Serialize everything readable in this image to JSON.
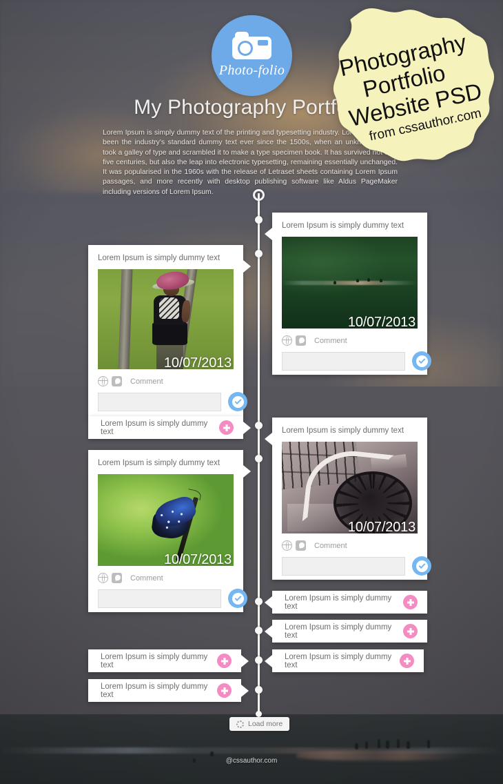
{
  "site": {
    "logo_name": "Photo-folio",
    "logo_icon": "camera-icon",
    "title": "My Photography Portfolio",
    "intro": "Lorem Ipsum is simply dummy text of the printing and typesetting industry. Lorem Ipsum has been the industry's standard dummy text ever since the 1500s, when an unknown printer took a galley of type and scrambled it to make a type specimen book. It has survived not only five centuries, but also the leap into electronic typesetting, remaining essentially unchanged. It was popularised in the 1960s with the release of Letraset sheets containing Lorem Ipsum passages, and more recently with desktop publishing software like Aldus PageMaker including versions of Lorem Ipsum.",
    "footer": "@cssauthor.com"
  },
  "badge": {
    "line1": "Photography",
    "line2": "Portfolio",
    "line3": "Website PSD",
    "line4": "from cssauthor.com",
    "color": "#f6f2bc"
  },
  "colors": {
    "accent_blue": "#74b7f2",
    "accent_pink": "#f48bc2",
    "logo_blue": "#6faae8",
    "card_white": "#ffffff"
  },
  "labels": {
    "comment": "Comment",
    "comment_placeholder": "",
    "load_more": "Load more",
    "post_icon": "check-icon",
    "add_icon": "plus-icon",
    "globe_icon": "globe-icon",
    "note_icon": "note-icon",
    "spinner_icon": "spinner-icon"
  },
  "posts": [
    {
      "id": "post-lake",
      "side": "right",
      "type": "photo",
      "title": "Lorem Ipsum is simply dummy text",
      "date": "10/07/2013",
      "photo": "lake-with-birds",
      "comment_label": "Comment",
      "comment_value": ""
    },
    {
      "id": "post-girl",
      "side": "left",
      "type": "photo",
      "title": "Lorem Ipsum is simply dummy text",
      "date": "10/07/2013",
      "photo": "girl-with-hat",
      "comment_label": "Comment",
      "comment_value": ""
    },
    {
      "id": "post-mini-left-1",
      "side": "left",
      "type": "text",
      "title": "Lorem Ipsum is simply dummy text"
    },
    {
      "id": "post-stairs",
      "side": "right",
      "type": "photo",
      "title": "Lorem Ipsum is simply dummy text",
      "date": "10/07/2013",
      "photo": "spiral-staircase",
      "comment_label": "Comment",
      "comment_value": ""
    },
    {
      "id": "post-butterfly",
      "side": "left",
      "type": "photo",
      "title": "Lorem Ipsum is simply dummy text",
      "date": "10/07/2013",
      "photo": "blue-butterfly",
      "comment_label": "Comment",
      "comment_value": ""
    },
    {
      "id": "post-mini-right-1",
      "side": "right",
      "type": "text",
      "title": "Lorem Ipsum is simply dummy text"
    },
    {
      "id": "post-mini-right-2",
      "side": "right",
      "type": "text",
      "title": "Lorem Ipsum is simply dummy text"
    },
    {
      "id": "post-mini-left-2",
      "side": "left",
      "type": "text",
      "title": "Lorem Ipsum is simply dummy text"
    },
    {
      "id": "post-mini-right-3",
      "side": "right",
      "type": "text",
      "title": "Lorem Ipsum is simply dummy text"
    },
    {
      "id": "post-mini-left-3",
      "side": "left",
      "type": "text",
      "title": "Lorem Ipsum is simply dummy text"
    }
  ]
}
